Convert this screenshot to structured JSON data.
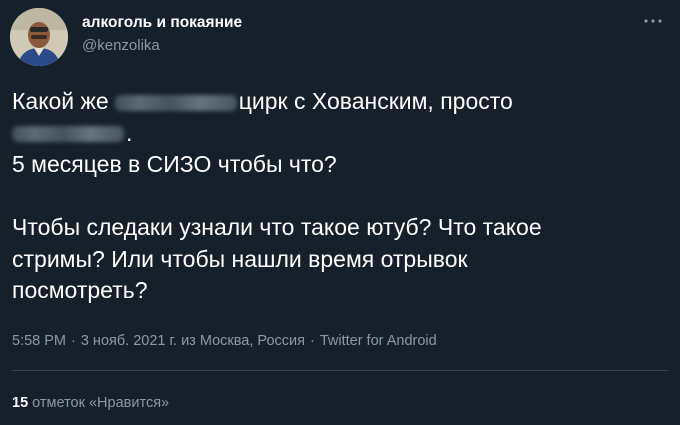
{
  "author": {
    "display_name": "алкоголь и покаяние",
    "username": "@kenzolika",
    "avatar_icon": "profile-photo"
  },
  "more_icon": "more-horizontal-icon",
  "tweet": {
    "line1_before": "Какой же",
    "line1_after": "цирк с Хованским, просто",
    "line2_after": ".",
    "line3": "5 месяцев в СИЗО чтобы что?",
    "line4": "Чтобы следаки узнали что такое ютуб? Что такое",
    "line5": "стримы? Или чтобы нашли время отрывок",
    "line6": "посмотреть?"
  },
  "meta": {
    "time": "5:58 PM",
    "separator": "·",
    "date": "3 нояб. 2021 г. из Москва, Россия",
    "client": "Twitter for Android"
  },
  "stats": {
    "likes_count": "15",
    "likes_label": "отметок «Нравится»"
  },
  "colors": {
    "background": "#15202b",
    "text_primary": "#ffffff",
    "text_secondary": "#8b98a5",
    "divider": "#38444d"
  }
}
